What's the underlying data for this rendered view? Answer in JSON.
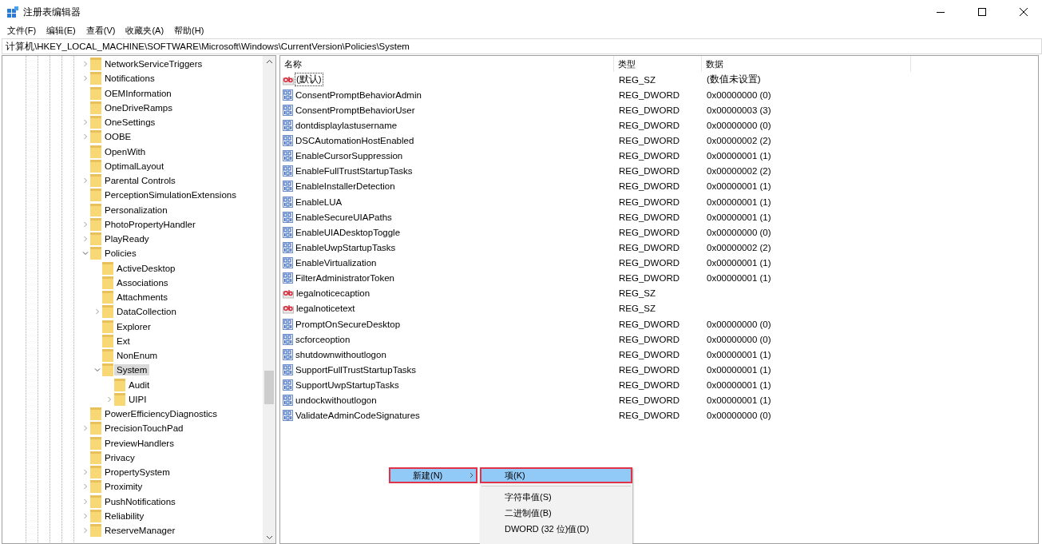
{
  "window": {
    "title": "注册表编辑器"
  },
  "menu": [
    "文件(F)",
    "编辑(E)",
    "查看(V)",
    "收藏夹(A)",
    "帮助(H)"
  ],
  "address": "计算机\\HKEY_LOCAL_MACHINE\\SOFTWARE\\Microsoft\\Windows\\CurrentVersion\\Policies\\System",
  "tree": [
    {
      "label": "NetworkServiceTriggers",
      "expandable": true,
      "expanded": false,
      "selected": false
    },
    {
      "label": "Notifications",
      "expandable": true,
      "expanded": false,
      "selected": false
    },
    {
      "label": "OEMInformation",
      "expandable": false,
      "expanded": false,
      "selected": false
    },
    {
      "label": "OneDriveRamps",
      "expandable": false,
      "expanded": false,
      "selected": false
    },
    {
      "label": "OneSettings",
      "expandable": true,
      "expanded": false,
      "selected": false
    },
    {
      "label": "OOBE",
      "expandable": true,
      "expanded": false,
      "selected": false
    },
    {
      "label": "OpenWith",
      "expandable": false,
      "expanded": false,
      "selected": false
    },
    {
      "label": "OptimalLayout",
      "expandable": false,
      "expanded": false,
      "selected": false
    },
    {
      "label": "Parental Controls",
      "expandable": true,
      "expanded": false,
      "selected": false
    },
    {
      "label": "PerceptionSimulationExtensions",
      "expandable": false,
      "expanded": false,
      "selected": false
    },
    {
      "label": "Personalization",
      "expandable": false,
      "expanded": false,
      "selected": false
    },
    {
      "label": "PhotoPropertyHandler",
      "expandable": true,
      "expanded": false,
      "selected": false
    },
    {
      "label": "PlayReady",
      "expandable": true,
      "expanded": false,
      "selected": false
    },
    {
      "label": "Policies",
      "expanded": true,
      "selected": false,
      "children": [
        {
          "label": "ActiveDesktop",
          "expandable": false,
          "expanded": false,
          "selected": false
        },
        {
          "label": "Associations",
          "expandable": false,
          "expanded": false,
          "selected": false
        },
        {
          "label": "Attachments",
          "expandable": false,
          "expanded": false,
          "selected": false
        },
        {
          "label": "DataCollection",
          "expandable": true,
          "expanded": false,
          "selected": false
        },
        {
          "label": "Explorer",
          "expandable": false,
          "expanded": false,
          "selected": false
        },
        {
          "label": "Ext",
          "expandable": false,
          "expanded": false,
          "selected": false
        },
        {
          "label": "NonEnum",
          "expandable": false,
          "expanded": false,
          "selected": false
        },
        {
          "label": "System",
          "expanded": true,
          "selected": true,
          "children": [
            {
              "label": "Audit",
              "expandable": false,
              "expanded": false,
              "selected": false
            },
            {
              "label": "UIPI",
              "expandable": true,
              "expanded": false,
              "selected": false
            }
          ]
        }
      ]
    },
    {
      "label": "PowerEfficiencyDiagnostics",
      "expandable": false,
      "expanded": false,
      "selected": false
    },
    {
      "label": "PrecisionTouchPad",
      "expandable": true,
      "expanded": false,
      "selected": false
    },
    {
      "label": "PreviewHandlers",
      "expandable": false,
      "expanded": false,
      "selected": false
    },
    {
      "label": "Privacy",
      "expandable": false,
      "expanded": false,
      "selected": false
    },
    {
      "label": "PropertySystem",
      "expandable": true,
      "expanded": false,
      "selected": false
    },
    {
      "label": "Proximity",
      "expandable": true,
      "expanded": false,
      "selected": false
    },
    {
      "label": "PushNotifications",
      "expandable": true,
      "expanded": false,
      "selected": false
    },
    {
      "label": "Reliability",
      "expandable": true,
      "expanded": false,
      "selected": false
    },
    {
      "label": "ReserveManager",
      "expandable": true,
      "expanded": false,
      "selected": false
    }
  ],
  "table": {
    "columns": [
      "名称",
      "类型",
      "数据"
    ],
    "rows": [
      {
        "kind": "sz",
        "name": "(默认)",
        "type": "REG_SZ",
        "data": "(数值未设置)",
        "focused": true
      },
      {
        "kind": "dword",
        "name": "ConsentPromptBehaviorAdmin",
        "type": "REG_DWORD",
        "data": "0x00000000 (0)",
        "focused": false
      },
      {
        "kind": "dword",
        "name": "ConsentPromptBehaviorUser",
        "type": "REG_DWORD",
        "data": "0x00000003 (3)",
        "focused": false
      },
      {
        "kind": "dword",
        "name": "dontdisplaylastusername",
        "type": "REG_DWORD",
        "data": "0x00000000 (0)",
        "focused": false
      },
      {
        "kind": "dword",
        "name": "DSCAutomationHostEnabled",
        "type": "REG_DWORD",
        "data": "0x00000002 (2)",
        "focused": false
      },
      {
        "kind": "dword",
        "name": "EnableCursorSuppression",
        "type": "REG_DWORD",
        "data": "0x00000001 (1)",
        "focused": false
      },
      {
        "kind": "dword",
        "name": "EnableFullTrustStartupTasks",
        "type": "REG_DWORD",
        "data": "0x00000002 (2)",
        "focused": false
      },
      {
        "kind": "dword",
        "name": "EnableInstallerDetection",
        "type": "REG_DWORD",
        "data": "0x00000001 (1)",
        "focused": false
      },
      {
        "kind": "dword",
        "name": "EnableLUA",
        "type": "REG_DWORD",
        "data": "0x00000001 (1)",
        "focused": false
      },
      {
        "kind": "dword",
        "name": "EnableSecureUIAPaths",
        "type": "REG_DWORD",
        "data": "0x00000001 (1)",
        "focused": false
      },
      {
        "kind": "dword",
        "name": "EnableUIADesktopToggle",
        "type": "REG_DWORD",
        "data": "0x00000000 (0)",
        "focused": false
      },
      {
        "kind": "dword",
        "name": "EnableUwpStartupTasks",
        "type": "REG_DWORD",
        "data": "0x00000002 (2)",
        "focused": false
      },
      {
        "kind": "dword",
        "name": "EnableVirtualization",
        "type": "REG_DWORD",
        "data": "0x00000001 (1)",
        "focused": false
      },
      {
        "kind": "dword",
        "name": "FilterAdministratorToken",
        "type": "REG_DWORD",
        "data": "0x00000001 (1)",
        "focused": false
      },
      {
        "kind": "sz",
        "name": "legalnoticecaption",
        "type": "REG_SZ",
        "focused": false
      },
      {
        "kind": "sz",
        "name": "legalnoticetext",
        "type": "REG_SZ",
        "focused": false
      },
      {
        "kind": "dword",
        "name": "PromptOnSecureDesktop",
        "type": "REG_DWORD",
        "data": "0x00000000 (0)",
        "focused": false
      },
      {
        "kind": "dword",
        "name": "scforceoption",
        "type": "REG_DWORD",
        "data": "0x00000000 (0)",
        "focused": false
      },
      {
        "kind": "dword",
        "name": "shutdownwithoutlogon",
        "type": "REG_DWORD",
        "data": "0x00000001 (1)",
        "focused": false
      },
      {
        "kind": "dword",
        "name": "SupportFullTrustStartupTasks",
        "type": "REG_DWORD",
        "data": "0x00000001 (1)",
        "focused": false
      },
      {
        "kind": "dword",
        "name": "SupportUwpStartupTasks",
        "type": "REG_DWORD",
        "data": "0x00000001 (1)",
        "focused": false
      },
      {
        "kind": "dword",
        "name": "undockwithoutlogon",
        "type": "REG_DWORD",
        "data": "0x00000001 (1)",
        "focused": false
      },
      {
        "kind": "dword",
        "name": "ValidateAdminCodeSignatures",
        "type": "REG_DWORD",
        "data": "0x00000000 (0)",
        "focused": false
      }
    ]
  },
  "context_menu": {
    "items": [
      {
        "label": "新建(N)",
        "selected": true,
        "outlined": true,
        "submenu": true
      }
    ]
  },
  "submenu": {
    "items": [
      {
        "label": "项(K)",
        "selected": true,
        "outlined": true
      },
      {
        "label": "字符串值(S)",
        "selected": false,
        "outlined": false,
        "separator_before": true
      },
      {
        "label": "二进制值(B)",
        "selected": false,
        "outlined": false
      },
      {
        "label": "DWORD (32 位)值(D)",
        "selected": false,
        "outlined": false
      }
    ]
  }
}
